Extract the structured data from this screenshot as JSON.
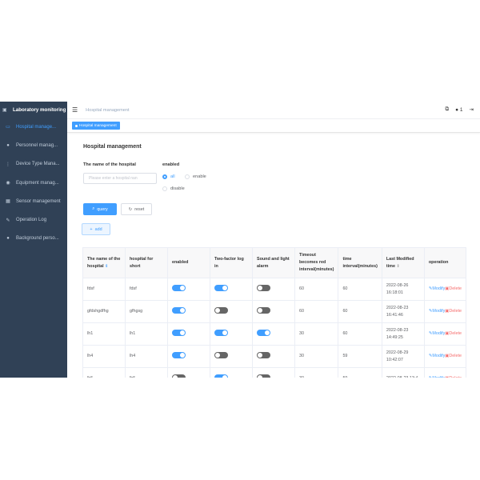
{
  "sidebar": {
    "title": "Laboratory monitoring",
    "items": [
      {
        "label": "Hospital manage...",
        "icon": "monitor-icon",
        "active": true
      },
      {
        "label": "Personnel manag...",
        "icon": "user-icon",
        "active": false
      },
      {
        "label": "Device Type Mana...",
        "icon": "sliders-icon",
        "active": false
      },
      {
        "label": "Equipment manag...",
        "icon": "equipment-icon",
        "active": false
      },
      {
        "label": "Sensor management",
        "icon": "sensor-icon",
        "active": false
      },
      {
        "label": "Operation Log",
        "icon": "edit-log-icon",
        "active": false
      },
      {
        "label": "Background perso...",
        "icon": "person-icon",
        "active": false
      }
    ]
  },
  "navbar": {
    "breadcrumb": "Hospital management",
    "user_count": "1"
  },
  "tags": {
    "active_tag": "Hospital management"
  },
  "page": {
    "title": "Hospital management",
    "name_label": "The name of the hospital",
    "name_placeholder": "Please enter a hospital nan",
    "enabled_label": "enabled",
    "radio_all": "all",
    "radio_enable": "enable",
    "radio_disable": "disable",
    "query_label": "query",
    "reset_label": "reset",
    "add_label": "add"
  },
  "table": {
    "headers": {
      "name": "The name of the hospital",
      "short": "hospital for short",
      "enabled": "enabled",
      "twofactor": "Two-factor log in",
      "alarm": "Sound and light alarm",
      "timeout": "Timeout becomes red interval(minutes)",
      "interval": "time interval(minutes)",
      "modified": "Last Modified time",
      "operation": "operation"
    },
    "modify_label": "Modify",
    "delete_label": "Delete",
    "rows": [
      {
        "name": "fdsf",
        "short": "fdsf",
        "enabled": true,
        "twofactor": true,
        "alarm": false,
        "timeout": "60",
        "interval": "60",
        "modified": "2022-08-26 16:18:01"
      },
      {
        "name": "gfdshgdfhg",
        "short": "gfhgsg",
        "enabled": true,
        "twofactor": false,
        "alarm": false,
        "timeout": "60",
        "interval": "60",
        "modified": "2022-08-23 16:41:46"
      },
      {
        "name": "lh1",
        "short": "lh1",
        "enabled": true,
        "twofactor": true,
        "alarm": true,
        "timeout": "30",
        "interval": "60",
        "modified": "2022-08-23 14:49:25"
      },
      {
        "name": "lh4",
        "short": "lh4",
        "enabled": true,
        "twofactor": false,
        "alarm": false,
        "timeout": "30",
        "interval": "59",
        "modified": "2022-08-29 10:42:07"
      },
      {
        "name": "lh5",
        "short": "lh5",
        "enabled": false,
        "twofactor": true,
        "alarm": false,
        "timeout": "30",
        "interval": "59",
        "modified": "2022-08-23 13:4"
      }
    ]
  },
  "colors": {
    "sidebar_bg": "#304156",
    "accent": "#409eff",
    "danger": "#f56c6c"
  }
}
